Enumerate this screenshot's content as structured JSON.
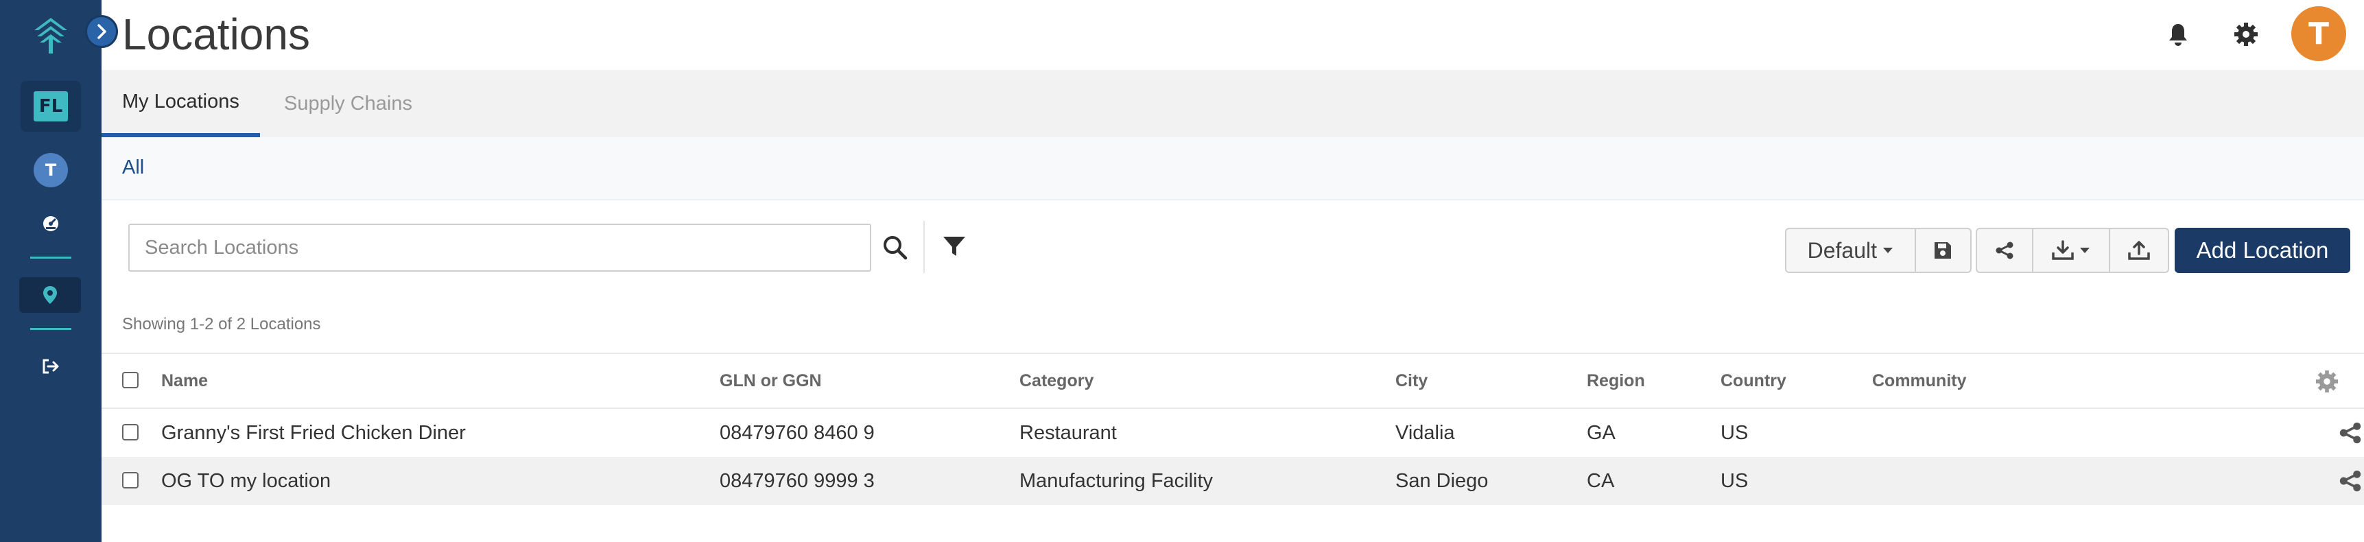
{
  "page": {
    "title": "Locations"
  },
  "sidebar": {
    "org_badge": "FL",
    "user_initial": "T"
  },
  "header": {
    "user_initial": "T"
  },
  "tabs": [
    {
      "label": "My Locations",
      "active": true
    },
    {
      "label": "Supply Chains",
      "active": false
    }
  ],
  "subtabs": [
    {
      "label": "All",
      "active": true
    }
  ],
  "search": {
    "placeholder": "Search Locations",
    "value": ""
  },
  "toolbar": {
    "view_label": "Default",
    "add_label": "Add Location"
  },
  "table": {
    "showing_text": "Showing 1-2 of 2 Locations",
    "columns": [
      "Name",
      "GLN or GGN",
      "Category",
      "City",
      "Region",
      "Country",
      "Community"
    ],
    "rows": [
      {
        "name": "Granny's First Fried Chicken Diner",
        "gln": "08479760 8460 9",
        "category": "Restaurant",
        "city": "Vidalia",
        "region": "GA",
        "country": "US",
        "community": ""
      },
      {
        "name": "OG TO my location",
        "gln": "08479760 9999 3",
        "category": "Manufacturing Facility",
        "city": "San Diego",
        "region": "CA",
        "country": "US",
        "community": ""
      }
    ]
  },
  "colors": {
    "sidebar": "#1d3e66",
    "accent": "#1d5fa8",
    "primary_button": "#1b3a66",
    "avatar": "#e8892f",
    "teal": "#3fb9c2"
  },
  "icons": [
    "app-logo-icon",
    "chevron-right-icon",
    "dashboard-icon",
    "location-pin-icon",
    "logout-icon",
    "bell-icon",
    "gear-icon",
    "search-icon",
    "filter-icon",
    "caret-down-icon",
    "save-icon",
    "share-icon",
    "download-icon",
    "upload-icon",
    "forward-icon",
    "trash-icon"
  ]
}
